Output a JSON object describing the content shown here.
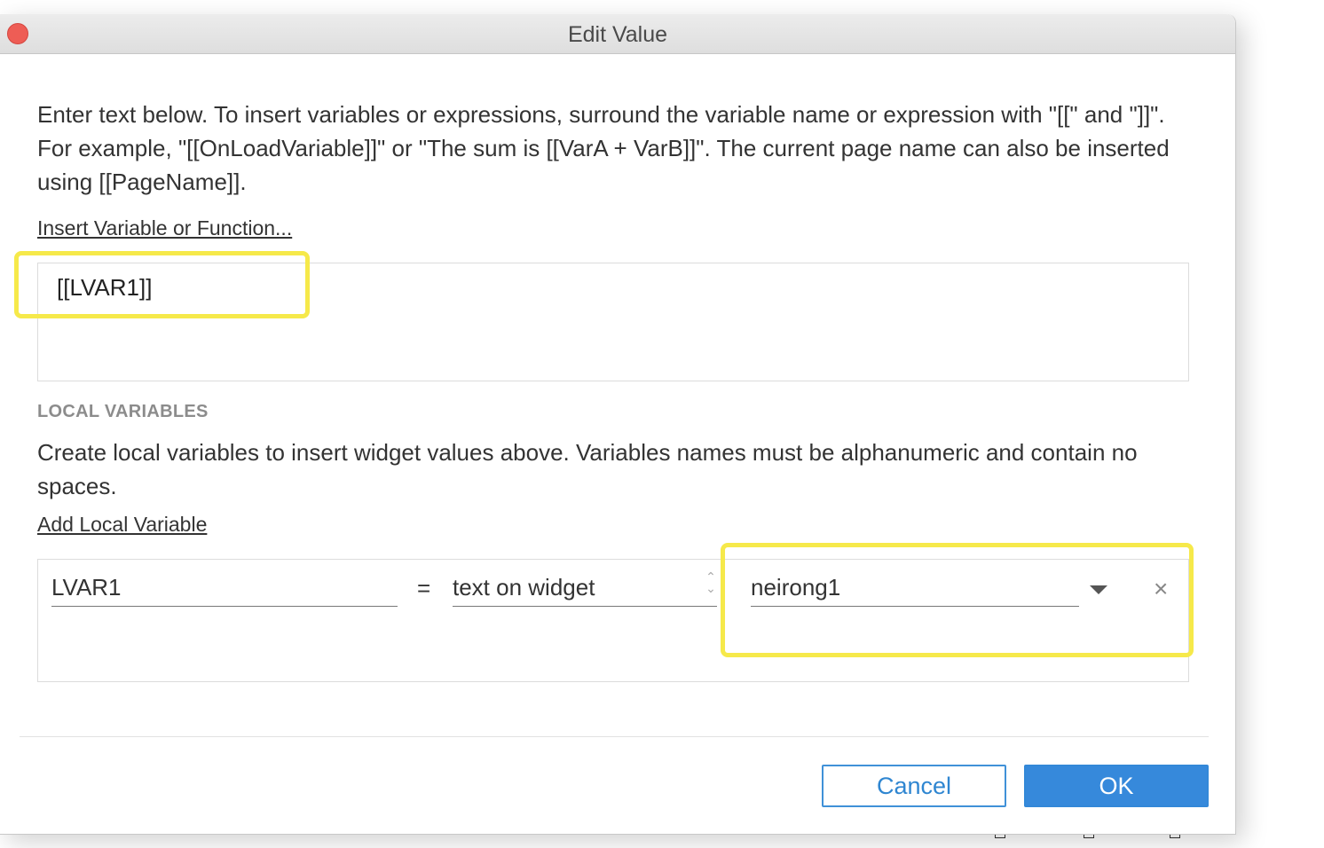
{
  "window": {
    "title": "Edit Value"
  },
  "description": "Enter text below. To insert variables or expressions, surround the variable name or expression with \"[[\" and \"]]\". For example, \"[[OnLoadVariable]]\" or \"The sum is [[VarA + VarB]]\". The current page name can also be inserted using [[PageName]].",
  "insert_link": "Insert Variable or Function...",
  "value_text": "[[LVAR1]]",
  "local_variables": {
    "heading": "LOCAL VARIABLES",
    "description": "Create local variables to insert widget values above. Variables names must be alphanumeric and contain no spaces.",
    "add_link": "Add Local Variable",
    "rows": [
      {
        "name": "LVAR1",
        "equals": "=",
        "source": "text on widget",
        "widget": "neirong1",
        "remove": "×"
      }
    ]
  },
  "buttons": {
    "cancel": "Cancel",
    "ok": "OK"
  },
  "colors": {
    "highlight": "#f6e94a",
    "primary_button": "#3689db",
    "close_dot": "#ee5d55"
  },
  "icons": {
    "close": "close-dot-icon",
    "stepper": "up-down-stepper-icon",
    "dropdown": "chevron-down-icon",
    "remove": "close-icon"
  }
}
